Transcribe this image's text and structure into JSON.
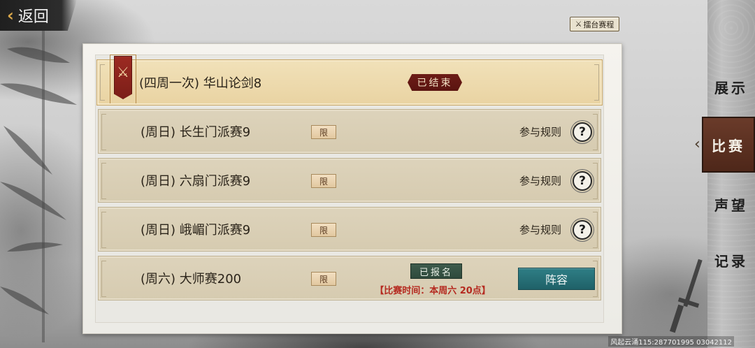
{
  "header": {
    "back_label": "返回",
    "schedule_label": "擂台赛程"
  },
  "events": [
    {
      "title": "(四周一次) 华山论剑8",
      "status": "已结束"
    },
    {
      "title": "(周日) 长生门派赛9",
      "limit": "限",
      "rule": "参与规则",
      "help": "?"
    },
    {
      "title": "(周日) 六扇门派赛9",
      "limit": "限",
      "rule": "参与规则",
      "help": "?"
    },
    {
      "title": "(周日) 峨嵋门派赛9",
      "limit": "限",
      "rule": "参与规则",
      "help": "?"
    },
    {
      "title": "(周六) 大师赛200",
      "limit": "限",
      "status": "已报名",
      "time": "【比赛时间：本周六 20点】",
      "button": "阵容"
    }
  ],
  "side_nav": {
    "items": [
      "展示",
      "比赛",
      "声望",
      "记录"
    ],
    "selected": "比赛"
  },
  "watermark": "风起云涌115:287701995 03042112",
  "colors": {
    "accent_red": "#6d1c17",
    "accent_teal": "#2f7e86",
    "accent_green": "#3e5b4c",
    "gold": "#d9a74a"
  }
}
